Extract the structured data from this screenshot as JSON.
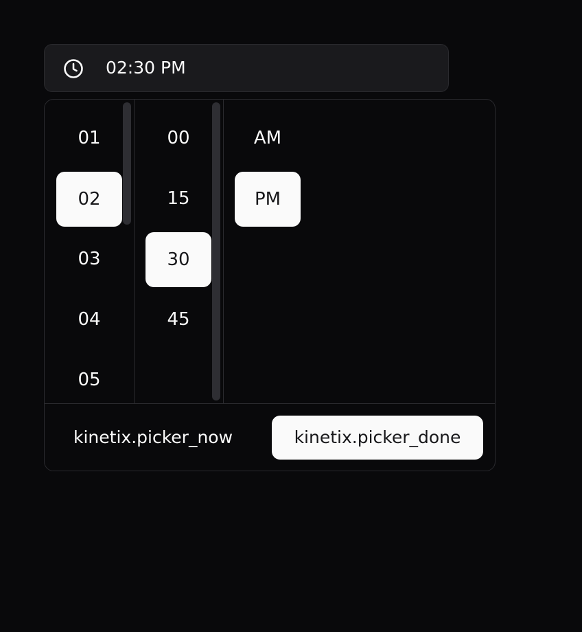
{
  "trigger": {
    "icon": "clock-icon",
    "value": "02:30 PM"
  },
  "hours": {
    "items": [
      "01",
      "02",
      "03",
      "04",
      "05"
    ],
    "selected": "02"
  },
  "minutes": {
    "items": [
      "00",
      "15",
      "30",
      "45"
    ],
    "selected": "30"
  },
  "meridiem": {
    "items": [
      "AM",
      "PM"
    ],
    "selected": "PM"
  },
  "footer": {
    "now_label": "kinetix.picker_now",
    "done_label": "kinetix.picker_done"
  },
  "colors": {
    "background": "#09090b",
    "surface": "#1a1a1d",
    "border": "#2a2a2e",
    "selected_bg": "#fafafa",
    "selected_text": "#18181b",
    "text": "#fafafa"
  }
}
